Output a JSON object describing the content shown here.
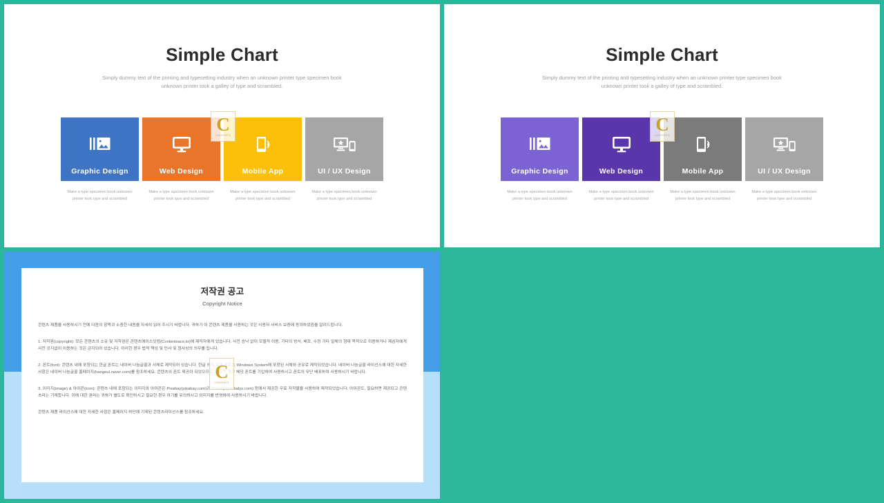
{
  "theme": {
    "background": "#2bb79b",
    "doc_blue_top": "#459fe8",
    "doc_blue_bottom": "#b6e0fa",
    "watermark_gold": "#c9a227"
  },
  "watermark": {
    "letter": "C",
    "tagline": "CONTENTS"
  },
  "slides": [
    {
      "id": "slide-1",
      "title": "Simple Chart",
      "subtitle_line_1": "Simply dummy text of the printing and typesetting industry when an unknown  printer type specimen book",
      "subtitle_line_2": "unknown  printer took a galley of type and scrambled.",
      "cards": [
        {
          "label": "Graphic Design",
          "color": "#3f73c4",
          "icon": "gallery-icon",
          "caption_line_1": "Make a type specimen book unknown",
          "caption_line_2": "printer took type and scrambled"
        },
        {
          "label": "Web Design",
          "color": "#e8752a",
          "icon": "monitor-icon",
          "caption_line_1": "Make a type specimen book unknown",
          "caption_line_2": "printer took type and scrambled"
        },
        {
          "label": "Mobile App",
          "color": "#fcc00a",
          "icon": "mobile-signal-icon",
          "caption_line_1": "Make a type specimen book unknown",
          "caption_line_2": "printer took type and scrambled"
        },
        {
          "label": "UI / UX Design",
          "color": "#a6a6a6",
          "icon": "responsive-star-icon",
          "caption_line_1": "Make a type specimen book unknown",
          "caption_line_2": "printer took type and scrambled"
        }
      ]
    },
    {
      "id": "slide-2",
      "title": "Simple Chart",
      "subtitle_line_1": "Simply dummy text of the printing and typesetting industry when an unknown  printer type specimen book",
      "subtitle_line_2": "unknown  printer took a galley of type and scrambled.",
      "cards": [
        {
          "label": "Graphic Design",
          "color": "#7b63d4",
          "icon": "gallery-icon",
          "caption_line_1": "Make a type specimen book unknown",
          "caption_line_2": "printer took type and scrambled"
        },
        {
          "label": "Web Design",
          "color": "#5a36ab",
          "icon": "monitor-icon",
          "caption_line_1": "Make a type specimen book unknown",
          "caption_line_2": "printer took type and scrambled"
        },
        {
          "label": "Mobile App",
          "color": "#7b7b7b",
          "icon": "mobile-signal-icon",
          "caption_line_1": "Make a type specimen book unknown",
          "caption_line_2": "printer took type and scrambled"
        },
        {
          "label": "UI / UX Design",
          "color": "#a6a6a6",
          "icon": "responsive-star-icon",
          "caption_line_1": "Make a type specimen book unknown",
          "caption_line_2": "printer took type and scrambled"
        }
      ]
    }
  ],
  "document": {
    "title_ko": "저작권 공고",
    "title_en": "Copyright Notice",
    "paragraphs": [
      "콘텐츠 제품을 사용하시기 전에 다음의 항목과 소중한 내용을 자세히 읽어 주시기 바랍니다. 귀하가 이 콘텐츠 제품을 사용하는 것은 사용자 서비스 보증에 동의하셨음을 알려드립니다.",
      "1. 저작권(copyright): 모든 콘텐츠의 소유 및 저작권은 콘텐츠에이스닷컴(Contentsaco.kr)에 제작자에게 있습니다. 사전 승낙 없이 모델적 이용, 기타의 방식, 배포, 수정 기타 일체의 형태 목적으로 이용하거나 제삼자에게 사전 공지없이 이용하는 것은 금지되어 있습니다. 이러한 경우 법적 책임 및 민사 및 형사상의 의무를 집니다.",
      "2. 폰트(font): 콘텐츠 내에 포함되는 한글 폰트는 네이버 나눔글꼴과 서체로 제작되어 있습니다. 한글 외의 로마 폰트는 Windows System에 포함된 서체와 공유로 제작되었습니다. 네이버 나눔글꼴 라이선스에 대한 자세한 사항은 네이버 나눔글꼴 홈페이지(hangeul.naver.com)를 참조하세요. 콘텐츠의 폰트 제공이 되었으므로, 필요한 경우 해당 폰트를 기입하여 사용하시고 폰트의 무단 배포하여 사용하시기 바랍니다.",
      "3. 이미지(image) & 아이콘(icon): 콘텐츠 내에 포함되는 이미지와 아이콘은 Pixabay(pixabay.com)과 Webalys(webalys.com) 등에서 제공한 무료 저작물을 사용하여 제작되었습니다. 아이콘도, 필요하면 제공되고 콘텐츠라는 기재합니다. 이에 대한 권리는 귀하가 별도로 확인하시고 필요한 경우 여기를 유의하시고 이미지를 반영하여 사용하시기 바랍니다.",
      "콘텐츠 제품 라이선스에 대한 자세한 사항은 홈페이지 하단에 기재된 콘텐츠라이선스를 참조하세요."
    ]
  }
}
